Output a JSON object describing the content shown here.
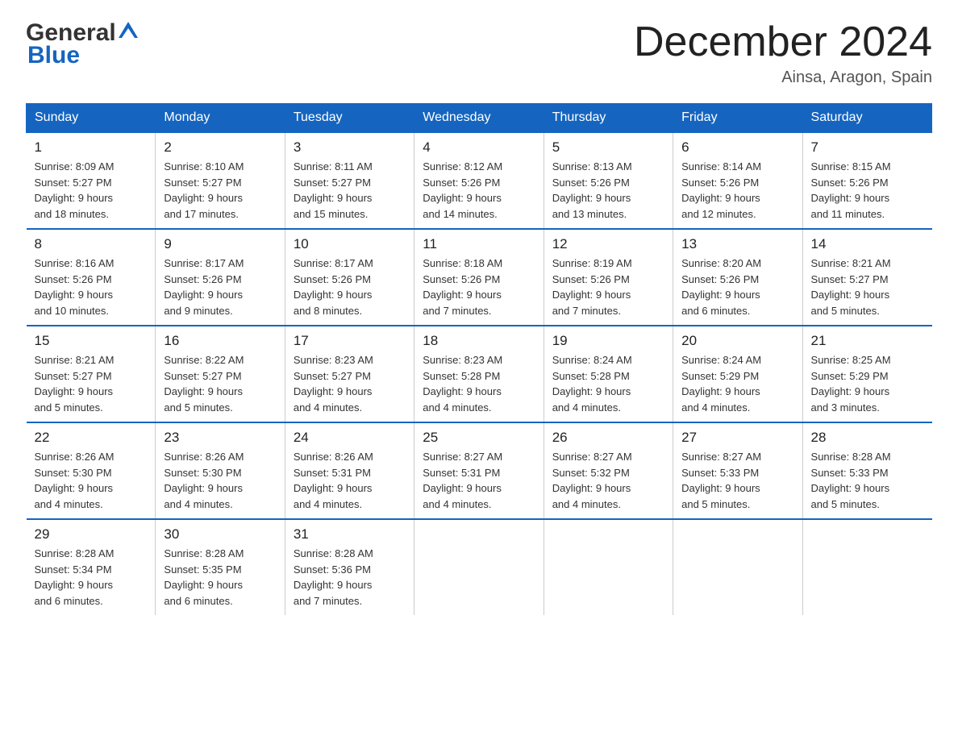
{
  "header": {
    "logo_general": "General",
    "logo_blue": "Blue",
    "month_title": "December 2024",
    "location": "Ainsa, Aragon, Spain"
  },
  "days_of_week": [
    "Sunday",
    "Monday",
    "Tuesday",
    "Wednesday",
    "Thursday",
    "Friday",
    "Saturday"
  ],
  "weeks": [
    [
      {
        "day": "1",
        "sunrise": "Sunrise: 8:09 AM",
        "sunset": "Sunset: 5:27 PM",
        "daylight": "Daylight: 9 hours",
        "daylight2": "and 18 minutes."
      },
      {
        "day": "2",
        "sunrise": "Sunrise: 8:10 AM",
        "sunset": "Sunset: 5:27 PM",
        "daylight": "Daylight: 9 hours",
        "daylight2": "and 17 minutes."
      },
      {
        "day": "3",
        "sunrise": "Sunrise: 8:11 AM",
        "sunset": "Sunset: 5:27 PM",
        "daylight": "Daylight: 9 hours",
        "daylight2": "and 15 minutes."
      },
      {
        "day": "4",
        "sunrise": "Sunrise: 8:12 AM",
        "sunset": "Sunset: 5:26 PM",
        "daylight": "Daylight: 9 hours",
        "daylight2": "and 14 minutes."
      },
      {
        "day": "5",
        "sunrise": "Sunrise: 8:13 AM",
        "sunset": "Sunset: 5:26 PM",
        "daylight": "Daylight: 9 hours",
        "daylight2": "and 13 minutes."
      },
      {
        "day": "6",
        "sunrise": "Sunrise: 8:14 AM",
        "sunset": "Sunset: 5:26 PM",
        "daylight": "Daylight: 9 hours",
        "daylight2": "and 12 minutes."
      },
      {
        "day": "7",
        "sunrise": "Sunrise: 8:15 AM",
        "sunset": "Sunset: 5:26 PM",
        "daylight": "Daylight: 9 hours",
        "daylight2": "and 11 minutes."
      }
    ],
    [
      {
        "day": "8",
        "sunrise": "Sunrise: 8:16 AM",
        "sunset": "Sunset: 5:26 PM",
        "daylight": "Daylight: 9 hours",
        "daylight2": "and 10 minutes."
      },
      {
        "day": "9",
        "sunrise": "Sunrise: 8:17 AM",
        "sunset": "Sunset: 5:26 PM",
        "daylight": "Daylight: 9 hours",
        "daylight2": "and 9 minutes."
      },
      {
        "day": "10",
        "sunrise": "Sunrise: 8:17 AM",
        "sunset": "Sunset: 5:26 PM",
        "daylight": "Daylight: 9 hours",
        "daylight2": "and 8 minutes."
      },
      {
        "day": "11",
        "sunrise": "Sunrise: 8:18 AM",
        "sunset": "Sunset: 5:26 PM",
        "daylight": "Daylight: 9 hours",
        "daylight2": "and 7 minutes."
      },
      {
        "day": "12",
        "sunrise": "Sunrise: 8:19 AM",
        "sunset": "Sunset: 5:26 PM",
        "daylight": "Daylight: 9 hours",
        "daylight2": "and 7 minutes."
      },
      {
        "day": "13",
        "sunrise": "Sunrise: 8:20 AM",
        "sunset": "Sunset: 5:26 PM",
        "daylight": "Daylight: 9 hours",
        "daylight2": "and 6 minutes."
      },
      {
        "day": "14",
        "sunrise": "Sunrise: 8:21 AM",
        "sunset": "Sunset: 5:27 PM",
        "daylight": "Daylight: 9 hours",
        "daylight2": "and 5 minutes."
      }
    ],
    [
      {
        "day": "15",
        "sunrise": "Sunrise: 8:21 AM",
        "sunset": "Sunset: 5:27 PM",
        "daylight": "Daylight: 9 hours",
        "daylight2": "and 5 minutes."
      },
      {
        "day": "16",
        "sunrise": "Sunrise: 8:22 AM",
        "sunset": "Sunset: 5:27 PM",
        "daylight": "Daylight: 9 hours",
        "daylight2": "and 5 minutes."
      },
      {
        "day": "17",
        "sunrise": "Sunrise: 8:23 AM",
        "sunset": "Sunset: 5:27 PM",
        "daylight": "Daylight: 9 hours",
        "daylight2": "and 4 minutes."
      },
      {
        "day": "18",
        "sunrise": "Sunrise: 8:23 AM",
        "sunset": "Sunset: 5:28 PM",
        "daylight": "Daylight: 9 hours",
        "daylight2": "and 4 minutes."
      },
      {
        "day": "19",
        "sunrise": "Sunrise: 8:24 AM",
        "sunset": "Sunset: 5:28 PM",
        "daylight": "Daylight: 9 hours",
        "daylight2": "and 4 minutes."
      },
      {
        "day": "20",
        "sunrise": "Sunrise: 8:24 AM",
        "sunset": "Sunset: 5:29 PM",
        "daylight": "Daylight: 9 hours",
        "daylight2": "and 4 minutes."
      },
      {
        "day": "21",
        "sunrise": "Sunrise: 8:25 AM",
        "sunset": "Sunset: 5:29 PM",
        "daylight": "Daylight: 9 hours",
        "daylight2": "and 3 minutes."
      }
    ],
    [
      {
        "day": "22",
        "sunrise": "Sunrise: 8:26 AM",
        "sunset": "Sunset: 5:30 PM",
        "daylight": "Daylight: 9 hours",
        "daylight2": "and 4 minutes."
      },
      {
        "day": "23",
        "sunrise": "Sunrise: 8:26 AM",
        "sunset": "Sunset: 5:30 PM",
        "daylight": "Daylight: 9 hours",
        "daylight2": "and 4 minutes."
      },
      {
        "day": "24",
        "sunrise": "Sunrise: 8:26 AM",
        "sunset": "Sunset: 5:31 PM",
        "daylight": "Daylight: 9 hours",
        "daylight2": "and 4 minutes."
      },
      {
        "day": "25",
        "sunrise": "Sunrise: 8:27 AM",
        "sunset": "Sunset: 5:31 PM",
        "daylight": "Daylight: 9 hours",
        "daylight2": "and 4 minutes."
      },
      {
        "day": "26",
        "sunrise": "Sunrise: 8:27 AM",
        "sunset": "Sunset: 5:32 PM",
        "daylight": "Daylight: 9 hours",
        "daylight2": "and 4 minutes."
      },
      {
        "day": "27",
        "sunrise": "Sunrise: 8:27 AM",
        "sunset": "Sunset: 5:33 PM",
        "daylight": "Daylight: 9 hours",
        "daylight2": "and 5 minutes."
      },
      {
        "day": "28",
        "sunrise": "Sunrise: 8:28 AM",
        "sunset": "Sunset: 5:33 PM",
        "daylight": "Daylight: 9 hours",
        "daylight2": "and 5 minutes."
      }
    ],
    [
      {
        "day": "29",
        "sunrise": "Sunrise: 8:28 AM",
        "sunset": "Sunset: 5:34 PM",
        "daylight": "Daylight: 9 hours",
        "daylight2": "and 6 minutes."
      },
      {
        "day": "30",
        "sunrise": "Sunrise: 8:28 AM",
        "sunset": "Sunset: 5:35 PM",
        "daylight": "Daylight: 9 hours",
        "daylight2": "and 6 minutes."
      },
      {
        "day": "31",
        "sunrise": "Sunrise: 8:28 AM",
        "sunset": "Sunset: 5:36 PM",
        "daylight": "Daylight: 9 hours",
        "daylight2": "and 7 minutes."
      },
      {
        "day": "",
        "sunrise": "",
        "sunset": "",
        "daylight": "",
        "daylight2": ""
      },
      {
        "day": "",
        "sunrise": "",
        "sunset": "",
        "daylight": "",
        "daylight2": ""
      },
      {
        "day": "",
        "sunrise": "",
        "sunset": "",
        "daylight": "",
        "daylight2": ""
      },
      {
        "day": "",
        "sunrise": "",
        "sunset": "",
        "daylight": "",
        "daylight2": ""
      }
    ]
  ]
}
